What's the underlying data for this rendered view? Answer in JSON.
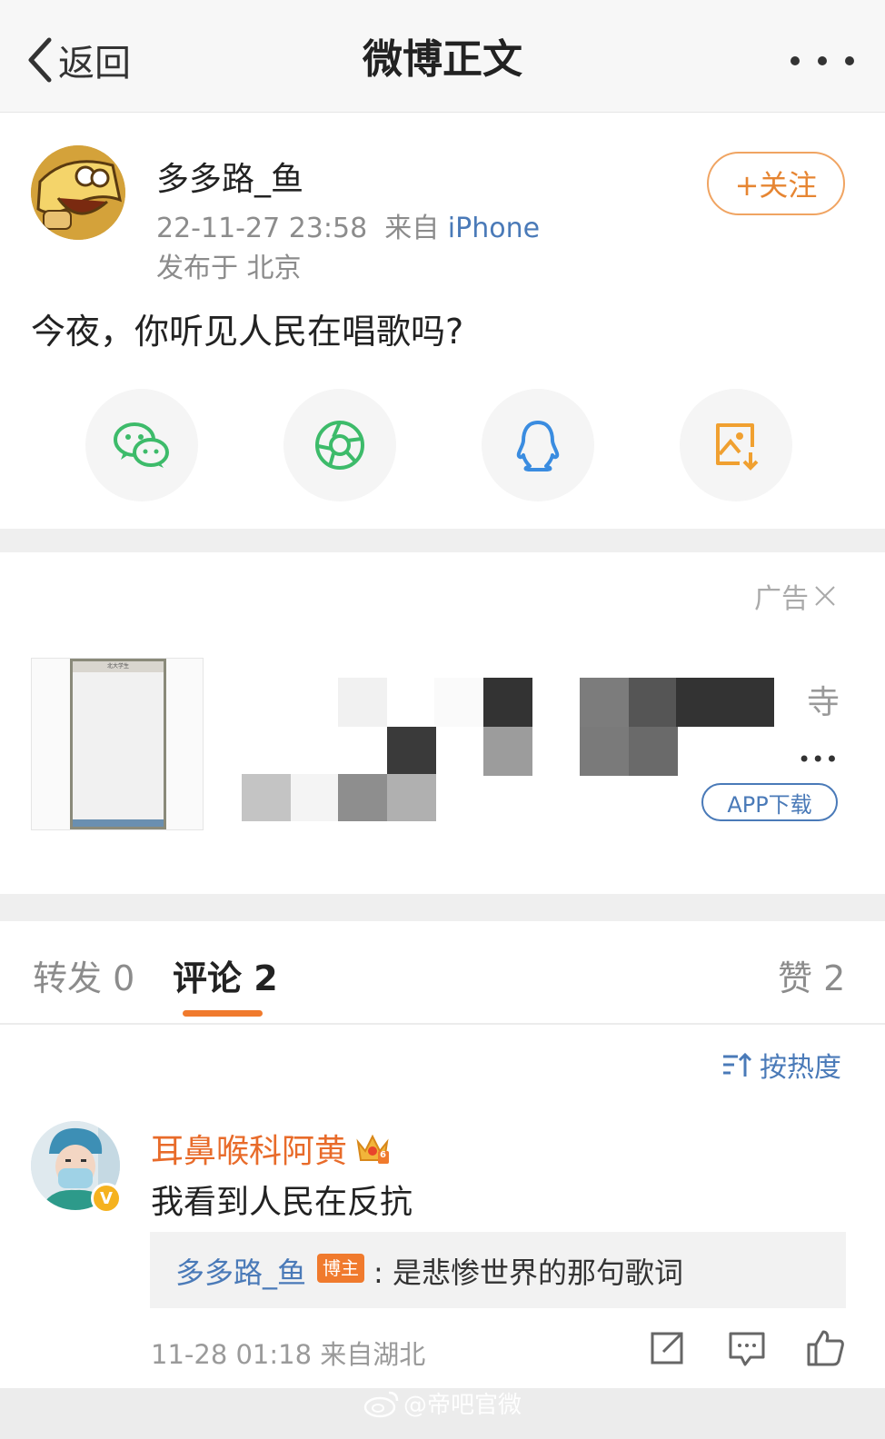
{
  "nav": {
    "back_label": "返回",
    "title": "微博正文"
  },
  "post": {
    "username": "多多路_鱼",
    "time": "22-11-27 23:58",
    "source_prefix": "来自",
    "source": "iPhone",
    "location": "发布于 北京",
    "follow_label": "+关注",
    "text": "今夜，你听见人民在唱歌吗?"
  },
  "share": [
    {
      "icon": "wechat-icon",
      "color": "#3dbb6a"
    },
    {
      "icon": "moments-icon",
      "color": "#3dbb6a"
    },
    {
      "icon": "qq-icon",
      "color": "#3a8ce0"
    },
    {
      "icon": "save-image-icon",
      "color": "#f0a030"
    }
  ],
  "ad": {
    "label": "广告",
    "thumb_title": "北大学生",
    "text_end": "寺",
    "more": "•••",
    "app_button": "APP下载"
  },
  "tabs": {
    "repost": "转发 0",
    "comment": "评论 2",
    "like": "赞 2"
  },
  "sort_label": "按热度",
  "comment": {
    "username": "耳鼻喉科阿黄",
    "badge_level": "6",
    "verified": "V",
    "text": "我看到人民在反抗",
    "reply_user": "多多路_鱼",
    "reply_badge": "博主",
    "reply_text": ": 是悲惨世界的那句歌词",
    "time_loc": "11-28 01:18  来自湖北"
  },
  "watermark": "@帝吧官微",
  "colors": {
    "accent_orange": "#f07a2d",
    "link_blue": "#4a7ab8"
  }
}
